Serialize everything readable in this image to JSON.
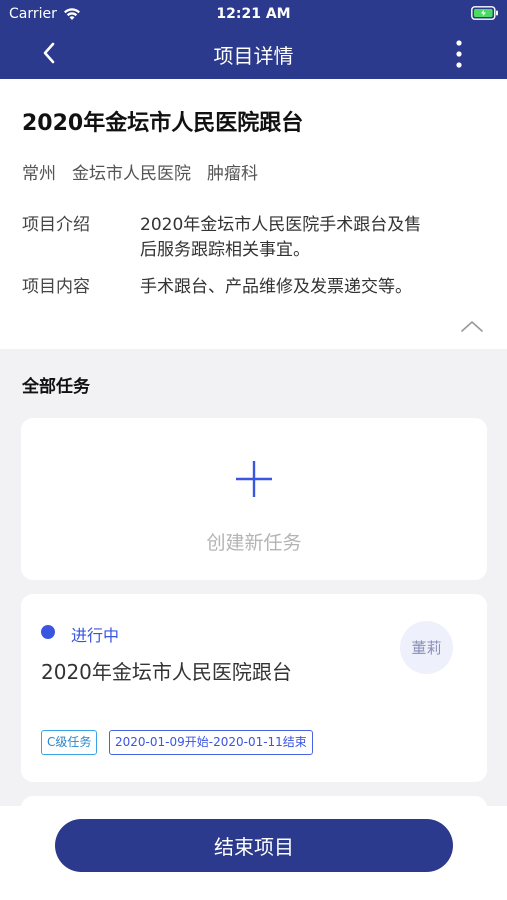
{
  "status_bar": {
    "carrier": "Carrier",
    "time": "12:21 AM"
  },
  "nav": {
    "title": "项目详情"
  },
  "project": {
    "title": "2020年金坛市人民医院跟台",
    "city": "常州",
    "hospital": "金坛市人民医院",
    "department": "肿瘤科",
    "intro_label": "项目介绍",
    "intro_line1": "2020年金坛市人民医院手术跟台及售",
    "intro_line2": "后服务跟踪相关事宜。",
    "content_label": "项目内容",
    "content_value": "手术跟台、产品维修及发票递交等。"
  },
  "tasks": {
    "section_title": "全部任务",
    "create_label": "创建新任务",
    "items": [
      {
        "status": "进行中",
        "title": "2020年金坛市人民医院跟台",
        "assignee": "董莉",
        "level_tag": "C级任务",
        "date_tag": "2020-01-09开始-2020-01-11结束"
      }
    ]
  },
  "footer": {
    "end_button": "结束项目"
  },
  "colors": {
    "primary": "#2b3a8c",
    "accent": "#3a55e0",
    "tag_blue": "#3aa3e8",
    "background": "#f2f2f4"
  }
}
